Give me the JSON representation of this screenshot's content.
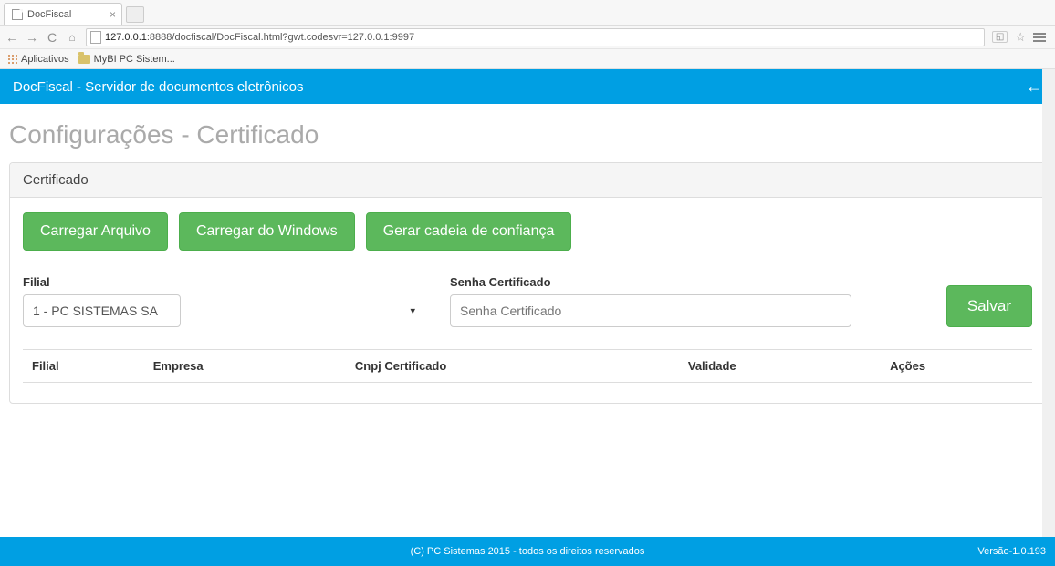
{
  "browser": {
    "tab_title": "DocFiscal",
    "url_host": "127.0.0.1",
    "url_rest": ":8888/docfiscal/DocFiscal.html?gwt.codesvr=127.0.0.1:9997",
    "bookmarks": {
      "apps": "Aplicativos",
      "folder1": "MyBI PC Sistem..."
    }
  },
  "header": {
    "title": "DocFiscal - Servidor de documentos eletrônicos"
  },
  "page": {
    "title": "Configurações - Certificado",
    "panel_title": "Certificado",
    "buttons": {
      "load_file": "Carregar Arquivo",
      "load_windows": "Carregar do Windows",
      "gen_chain": "Gerar cadeia de confiança",
      "save": "Salvar"
    },
    "form": {
      "filial_label": "Filial",
      "filial_value": "1 - PC SISTEMAS SA",
      "senha_label": "Senha Certificado",
      "senha_placeholder": "Senha Certificado"
    },
    "table_headers": {
      "filial": "Filial",
      "empresa": "Empresa",
      "cnpj": "Cnpj Certificado",
      "validade": "Validade",
      "acoes": "Ações"
    }
  },
  "footer": {
    "copyright": "(C) PC Sistemas 2015 - todos os direitos reservados",
    "version": "Versão-1.0.193"
  }
}
